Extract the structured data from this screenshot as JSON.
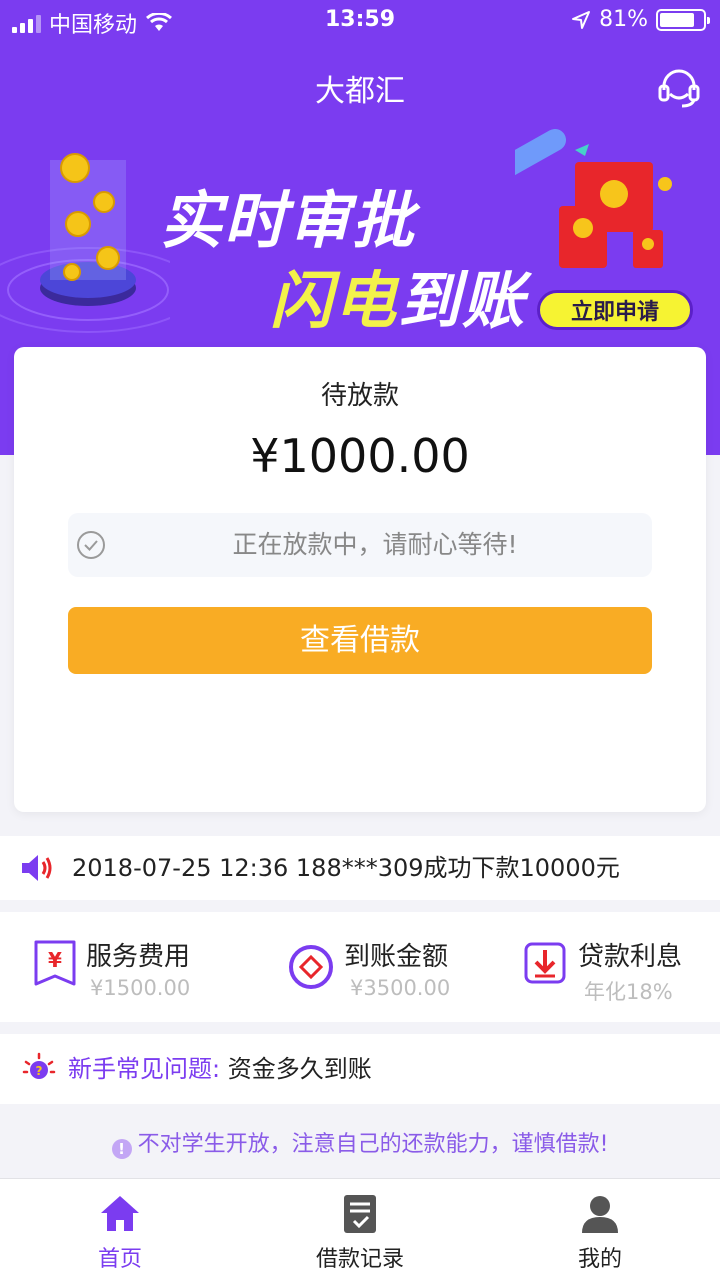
{
  "status_bar": {
    "carrier": "中国移动",
    "time": "13:59",
    "battery": "81%",
    "battery_level": 0.81
  },
  "header": {
    "title": "大都汇",
    "support_icon": "headset-icon"
  },
  "banner": {
    "line1": "实时审批",
    "line2_highlight": "闪电",
    "line2_rest": "到账",
    "button_label": "立即申请"
  },
  "card": {
    "label": "待放款",
    "amount": "¥1000.00",
    "notice": "正在放款中，请耐心等待!",
    "button_label": "查看借款"
  },
  "broadcast": {
    "text": "2018-07-25 12:36 188***309成功下款10000元"
  },
  "stats": [
    {
      "title": "服务费用",
      "value": "¥1500.00",
      "icon": "service-fee-icon"
    },
    {
      "title": "到账金额",
      "value": "¥3500.00",
      "icon": "amount-received-icon"
    },
    {
      "title": "贷款利息",
      "value": "年化18%",
      "icon": "interest-icon"
    }
  ],
  "faq": {
    "label": "新手常见问题:",
    "question": "资金多久到账"
  },
  "warning": {
    "text": "不对学生开放，注意自己的还款能力，谨慎借款!"
  },
  "tabbar": {
    "items": [
      {
        "label": "首页",
        "icon": "home-icon",
        "active": true
      },
      {
        "label": "借款记录",
        "icon": "loan-record-icon",
        "active": false
      },
      {
        "label": "我的",
        "icon": "profile-icon",
        "active": false
      }
    ]
  },
  "colors": {
    "brand_purple": "#7b3cf0",
    "button_orange": "#f9ac24",
    "banner_yellow": "#f3f24a"
  }
}
